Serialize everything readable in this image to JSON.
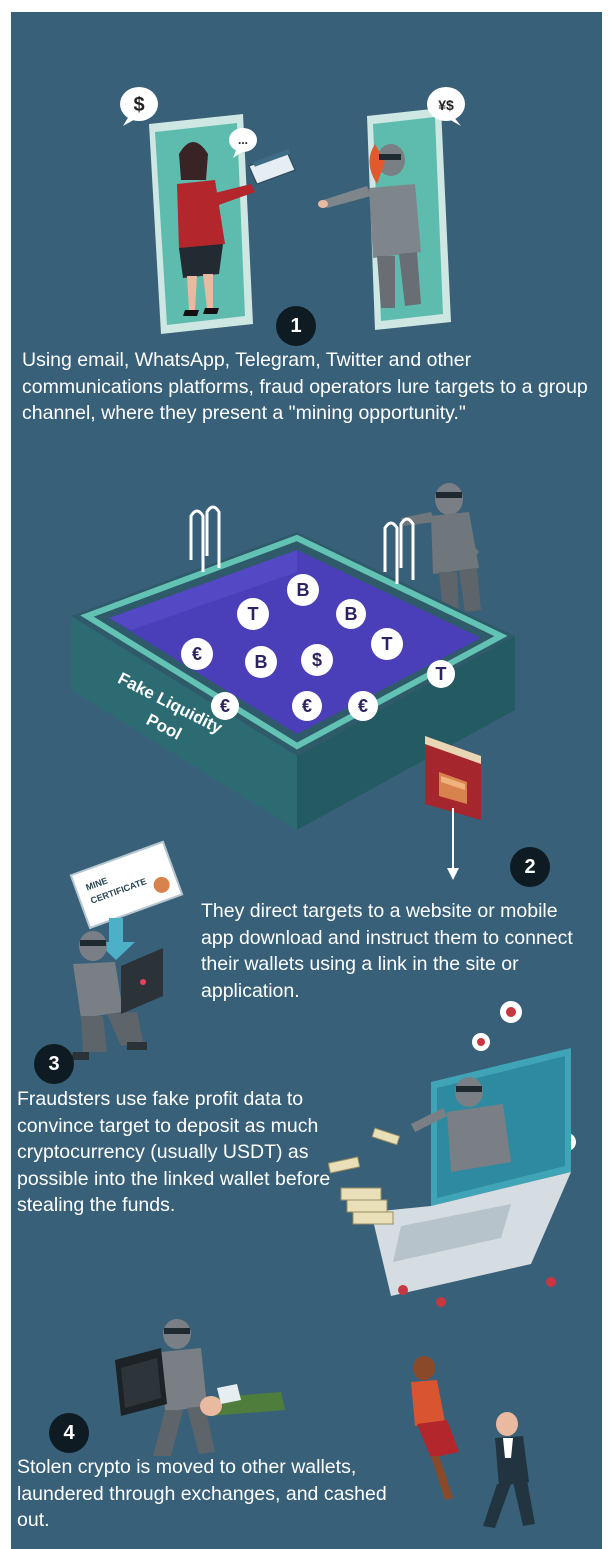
{
  "colors": {
    "panel_background": "#386079",
    "badge": "#0e1b22",
    "text": "#ffffff",
    "pool_water": "#4a3fb8",
    "pool_rim": "#4fb0a4",
    "sign_red": "#a6262d"
  },
  "steps": [
    {
      "number": "1",
      "text": "Using email, WhatsApp, Telegram, Twitter and other communications platforms, fraud operators lure targets to a group channel, where they present a \"mining opportunity.\""
    },
    {
      "number": "2",
      "text": "They direct targets to a website or mobile app download and instruct them to connect their wallets using a link in the site or application."
    },
    {
      "number": "3",
      "text": "Fraudsters use fake profit data to convince target to deposit as much cryptocurrency (usually USDT) as possible into the linked wallet before stealing the funds."
    },
    {
      "number": "4",
      "text": "Stolen crypto is moved to other wallets, laundered through exchanges, and cashed out."
    }
  ],
  "illustrations": {
    "phones": {
      "speech_bubbles": [
        "$",
        "...",
        "¥$"
      ]
    },
    "pool": {
      "label_line1": "Fake Liquidity",
      "label_line2": "Pool",
      "coins": [
        "B",
        "T",
        "B",
        "T",
        "€",
        "B",
        "$",
        "T",
        "€",
        "€",
        "€"
      ]
    },
    "certificate": {
      "line1": "MINE",
      "line2": "CERTIFICATE"
    }
  }
}
